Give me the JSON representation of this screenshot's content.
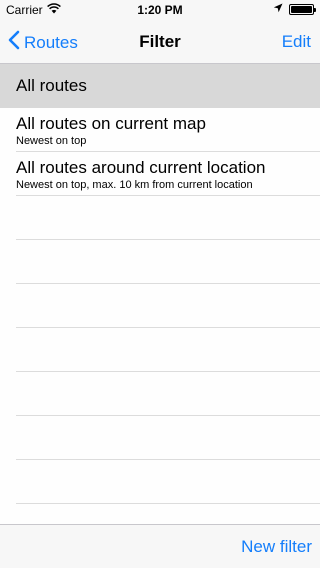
{
  "status_bar": {
    "carrier": "Carrier",
    "time": "1:20 PM"
  },
  "nav": {
    "back_label": "Routes",
    "title": "Filter",
    "edit_label": "Edit"
  },
  "list": {
    "selected_item": "All routes",
    "items": [
      {
        "title": "All routes on current map",
        "subtitle": "Newest on top"
      },
      {
        "title": "All routes around current location",
        "subtitle": "Newest on top, max. 10 km from current location"
      }
    ]
  },
  "toolbar": {
    "new_filter_label": "New filter"
  },
  "colors": {
    "accent": "#147efb",
    "selected_row_bg": "#d8d8d8"
  },
  "icons": {
    "wifi": "wifi-icon",
    "location": "location-arrow-icon",
    "battery": "battery-icon",
    "back": "chevron-left-icon"
  }
}
